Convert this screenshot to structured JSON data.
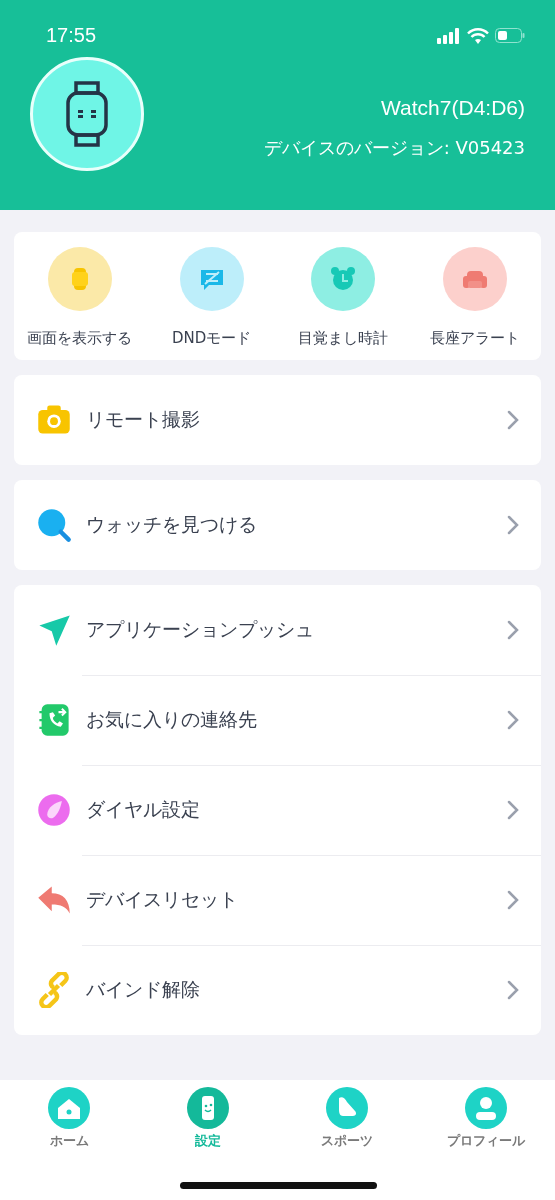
{
  "status_bar": {
    "time": "17:55"
  },
  "device": {
    "name": "Watch7(D4:D6)",
    "version": "デバイスのバージョン: V05423"
  },
  "quick_actions": [
    {
      "label": "画面を表示する",
      "color": "#fbe9a8"
    },
    {
      "label": "DNDモード",
      "color": "#bdeefa"
    },
    {
      "label": "目覚まし時計",
      "color": "#8eeee3"
    },
    {
      "label": "長座アラート",
      "color": "#fcd0cc"
    }
  ],
  "cards": [
    {
      "items": [
        {
          "label": "リモート撮影"
        }
      ]
    },
    {
      "items": [
        {
          "label": "ウォッチを見つける"
        }
      ]
    },
    {
      "items": [
        {
          "label": "アプリケーションプッシュ"
        },
        {
          "label": "お気に入りの連絡先"
        },
        {
          "label": "ダイヤル設定"
        },
        {
          "label": "デバイスリセット"
        },
        {
          "label": "バインド解除"
        }
      ]
    }
  ],
  "tab_bar": [
    {
      "label": "ホーム",
      "selected": false
    },
    {
      "label": "設定",
      "selected": true
    },
    {
      "label": "スポーツ",
      "selected": false
    },
    {
      "label": "プロフィール",
      "selected": false
    }
  ]
}
